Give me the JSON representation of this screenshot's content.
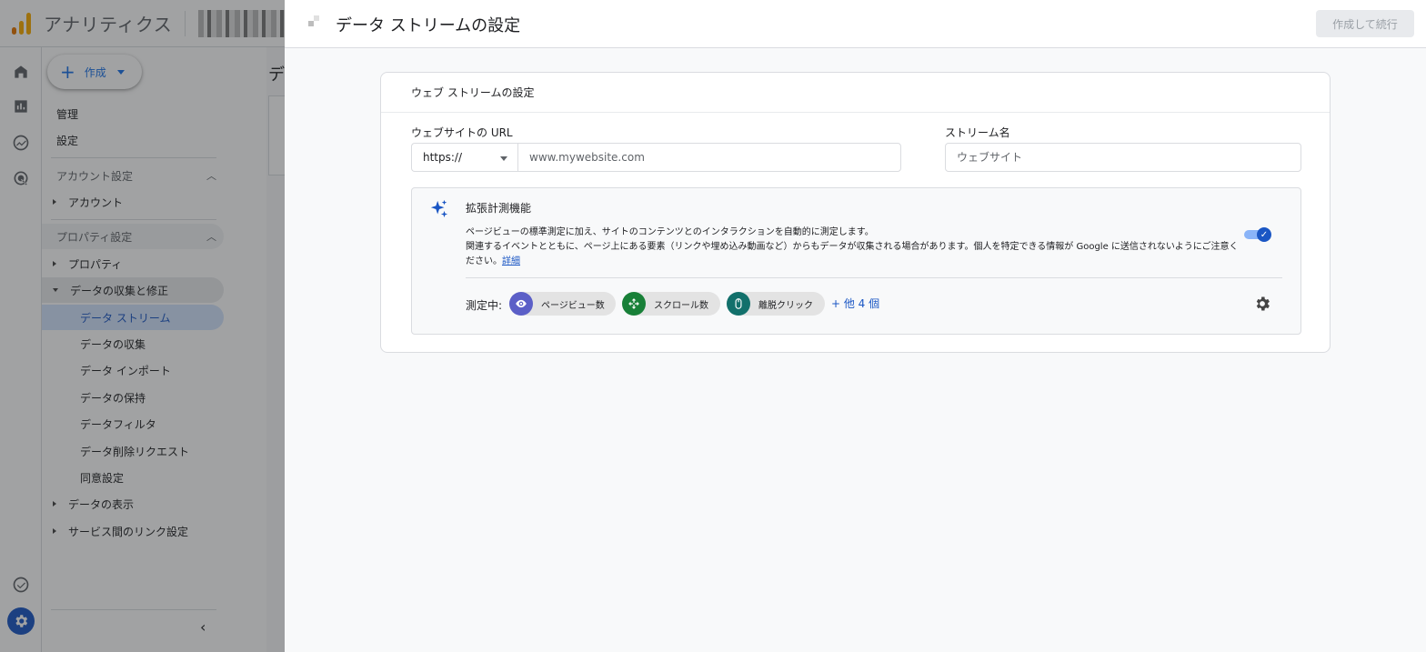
{
  "app": {
    "title": "アナリティクス"
  },
  "nav": {
    "create_label": "作成",
    "admin": "管理",
    "settings": "設定",
    "account_settings": "アカウント設定",
    "account": "アカウント",
    "property_settings": "プロパティ設定",
    "property": "プロパティ",
    "data_collection_group": "データの収集と修正",
    "data_streams": "データ ストリーム",
    "data_collection": "データの収集",
    "data_import": "データ インポート",
    "data_retention": "データの保持",
    "data_filters": "データフィルタ",
    "data_deletion": "データ削除リクエスト",
    "consent": "同意設定",
    "data_display": "データの表示",
    "product_links": "サービス間のリンク設定"
  },
  "main_peek": {
    "title_fragment": "デ"
  },
  "panel": {
    "title": "データ ストリームの設定",
    "primary_button": "作成して続行",
    "card_title": "ウェブ ストリームの設定",
    "url_label": "ウェブサイトの URL",
    "protocol_value": "https://",
    "url_placeholder": "www.mywebsite.com",
    "stream_name_label": "ストリーム名",
    "stream_name_placeholder": "ウェブサイト",
    "enhanced": {
      "title": "拡張計測機能",
      "desc_line1": "ページビューの標準測定に加え、サイトのコンテンツとのインタラクションを自動的に測定します。",
      "desc_line2": "関連するイベントとともに、ページ上にある要素（リンクや埋め込み動画など）からもデータが収集される場合があります。個人を特定できる情報が Google に送信されないようにご注意ください。",
      "details_link": "詳細",
      "enabled": true,
      "measuring_label": "測定中:",
      "chips": [
        {
          "label": "ページビュー数",
          "icon": "eye-icon",
          "color": "#5b5fc7"
        },
        {
          "label": "スクロール数",
          "icon": "scroll-icon",
          "color": "#188038"
        },
        {
          "label": "離脱クリック",
          "icon": "mouse-icon",
          "color": "#12706b"
        }
      ],
      "more_link": "+ 他 4 個"
    }
  },
  "colors": {
    "accent": "#1a56c4",
    "logo_orange": "#f9ab00",
    "logo_dark": "#e37400"
  }
}
